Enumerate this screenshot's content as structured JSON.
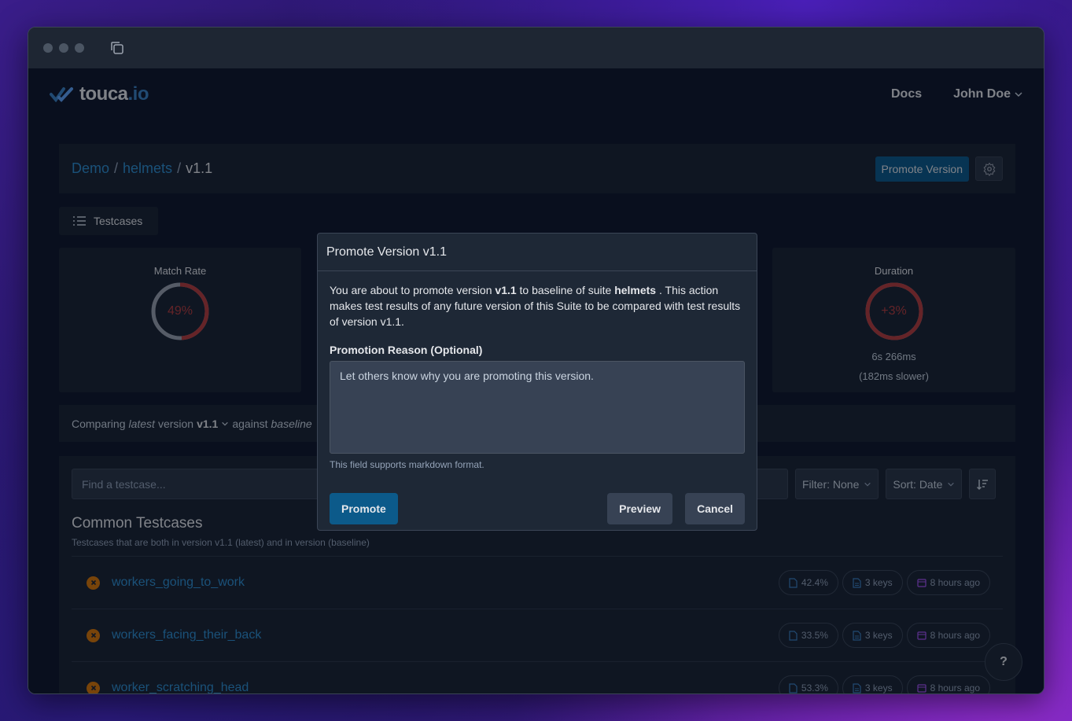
{
  "nav": {
    "logo_main": "touca",
    "logo_io": ".io",
    "docs": "Docs",
    "user": "John Doe"
  },
  "breadcrumb": {
    "team": "Demo",
    "suite": "helmets",
    "version": "v1.1",
    "sep": "/"
  },
  "header": {
    "promote_label": "Promote Version"
  },
  "tabs": {
    "testcases": "Testcases"
  },
  "cards": {
    "match_rate": {
      "label": "Match Rate",
      "value": "49%",
      "fraction": 0.49
    },
    "duration": {
      "label": "Duration",
      "value": "+3%",
      "fraction": 1.0,
      "time": "6s 266ms",
      "delta": "(182ms slower)"
    }
  },
  "compare": {
    "prefix": "Comparing",
    "latest": "latest",
    "version_word": "version",
    "version": "v1.1",
    "against": "against",
    "baseline": "baseline"
  },
  "list": {
    "search_placeholder": "Find a testcase...",
    "filter": "Filter: None",
    "sort": "Sort: Date",
    "section_title": "Common Testcases",
    "section_sub": "Testcases that are both in version v1.1 (latest) and in version (baseline)",
    "rows": [
      {
        "name": "workers_going_to_work",
        "match": "42.4%",
        "keys": "3 keys",
        "time": "8 hours ago"
      },
      {
        "name": "workers_facing_their_back",
        "match": "33.5%",
        "keys": "3 keys",
        "time": "8 hours ago"
      },
      {
        "name": "worker_scratching_head",
        "match": "53.3%",
        "keys": "3 keys",
        "time": "8 hours ago"
      }
    ]
  },
  "help": "?",
  "modal": {
    "title": "Promote Version v1.1",
    "text_1": "You are about to promote version",
    "version": "v1.1",
    "text_2": "to baseline of suite",
    "suite": "helmets",
    "text_3": ". This action makes test results of any future version of this Suite to be compared with test results of version v1.1.",
    "field_label": "Promotion Reason (Optional)",
    "placeholder": "Let others know why you are promoting this version.",
    "hint": "This field supports markdown format.",
    "promote": "Promote",
    "preview": "Preview",
    "cancel": "Cancel"
  }
}
